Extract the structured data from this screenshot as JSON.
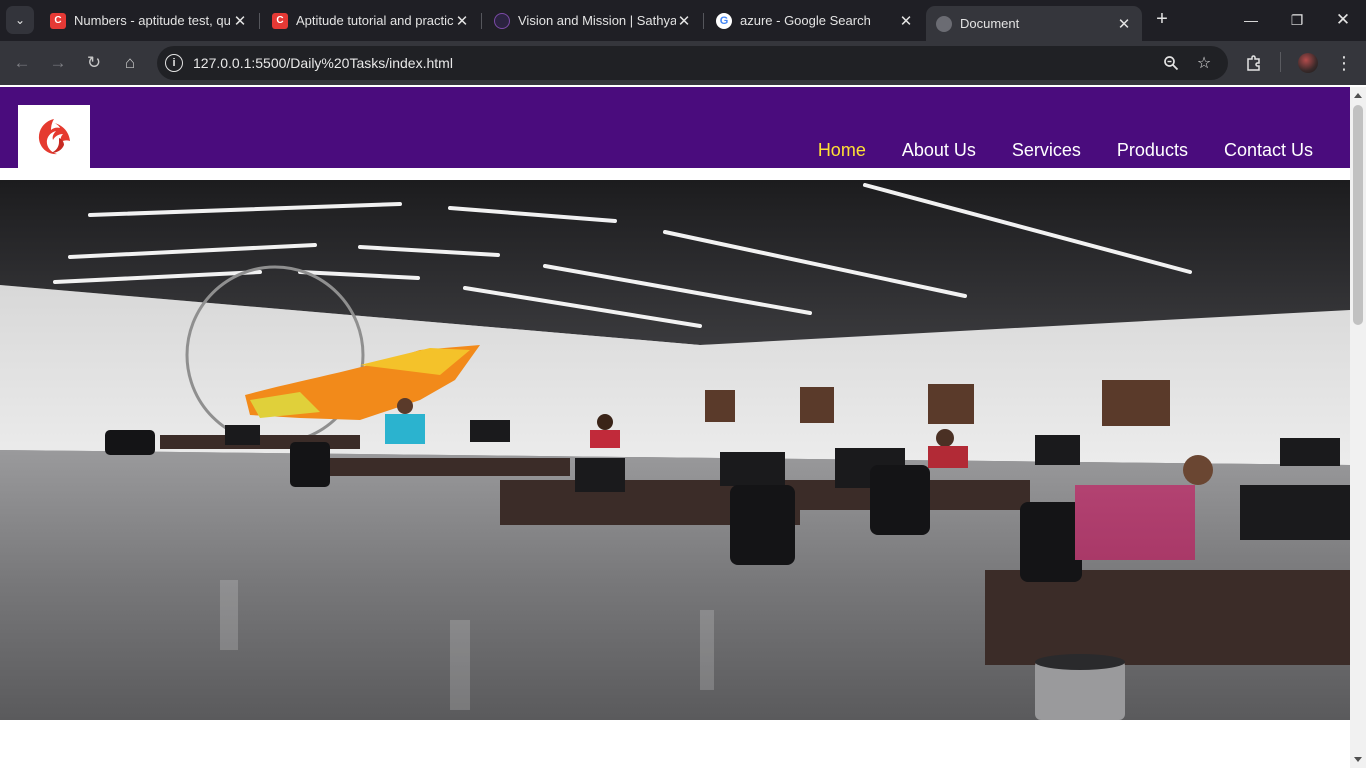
{
  "browser": {
    "tabs": [
      {
        "title": "Numbers - aptitude test, qu",
        "favicon": "c-icon"
      },
      {
        "title": "Aptitude tutorial and practic",
        "favicon": "c-icon"
      },
      {
        "title": "Vision and Mission | Sathyab",
        "favicon": "university-icon"
      },
      {
        "title": "azure - Google Search",
        "favicon": "google-icon"
      },
      {
        "title": "Document",
        "favicon": "globe-icon"
      }
    ],
    "active_tab": 4,
    "url": "127.0.0.1:5500/Daily%20Tasks/index.html"
  },
  "site": {
    "header_color": "#4a0c7d",
    "active_link_color": "#ffe135",
    "nav": [
      {
        "label": "Home",
        "active": true
      },
      {
        "label": "About Us",
        "active": false
      },
      {
        "label": "Services",
        "active": false
      },
      {
        "label": "Products",
        "active": false
      },
      {
        "label": "Contact Us",
        "active": false
      }
    ],
    "hero": {
      "description": "open office with desks, people working, ceiling lights and mural"
    }
  }
}
